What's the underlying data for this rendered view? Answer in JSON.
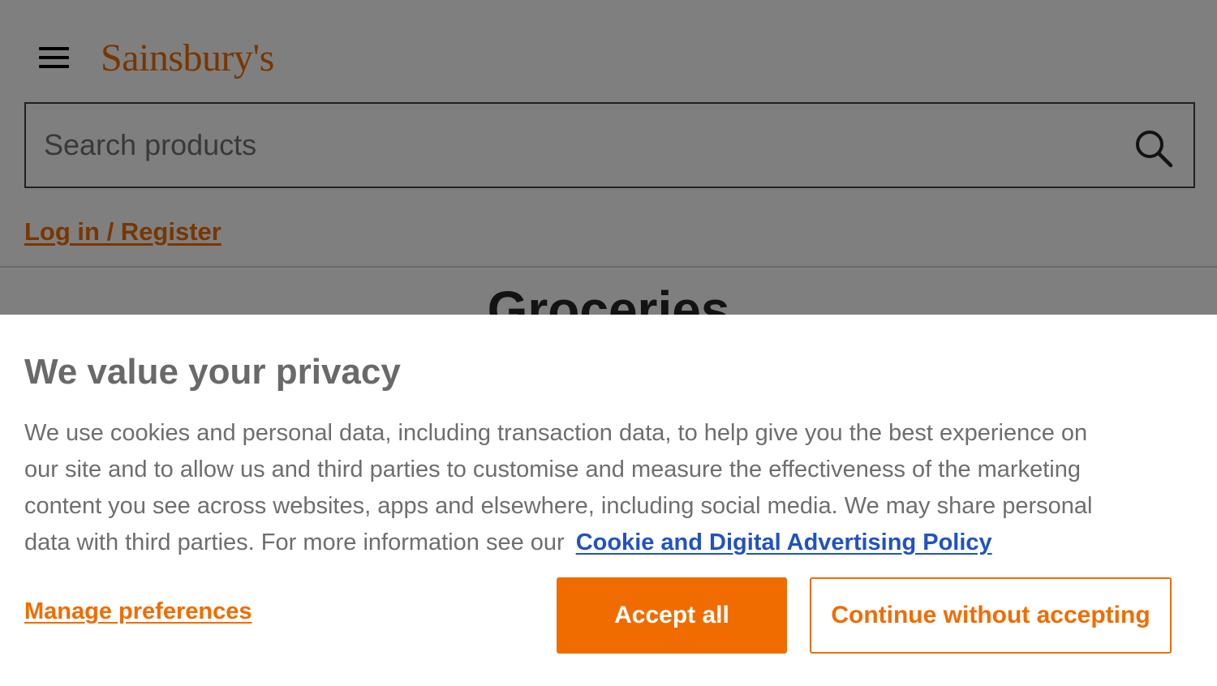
{
  "header": {
    "logo_text": "Sainsbury's",
    "search": {
      "placeholder": "Search products"
    },
    "login_label": "Log in / Register"
  },
  "main": {
    "title": "Groceries"
  },
  "cookie_banner": {
    "title": "We value your privacy",
    "body": "We use cookies and personal data, including transaction data, to help give you the best experience on our site and to allow us and third parties to customise and measure the effectiveness of the marketing content you see across websites, apps and elsewhere, including social media. We may share personal data with third parties. For more information see our",
    "policy_link": "Cookie and Digital Advertising Policy",
    "manage_label": "Manage preferences",
    "accept_label": "Accept all",
    "continue_label": "Continue without accepting"
  },
  "icons": {
    "menu": "hamburger-menu-icon",
    "search": "magnifier-icon"
  },
  "colors": {
    "brand_orange": "#f06c00",
    "link_blue": "#2152c4",
    "overlay": "rgba(0,0,0,0.5)"
  }
}
